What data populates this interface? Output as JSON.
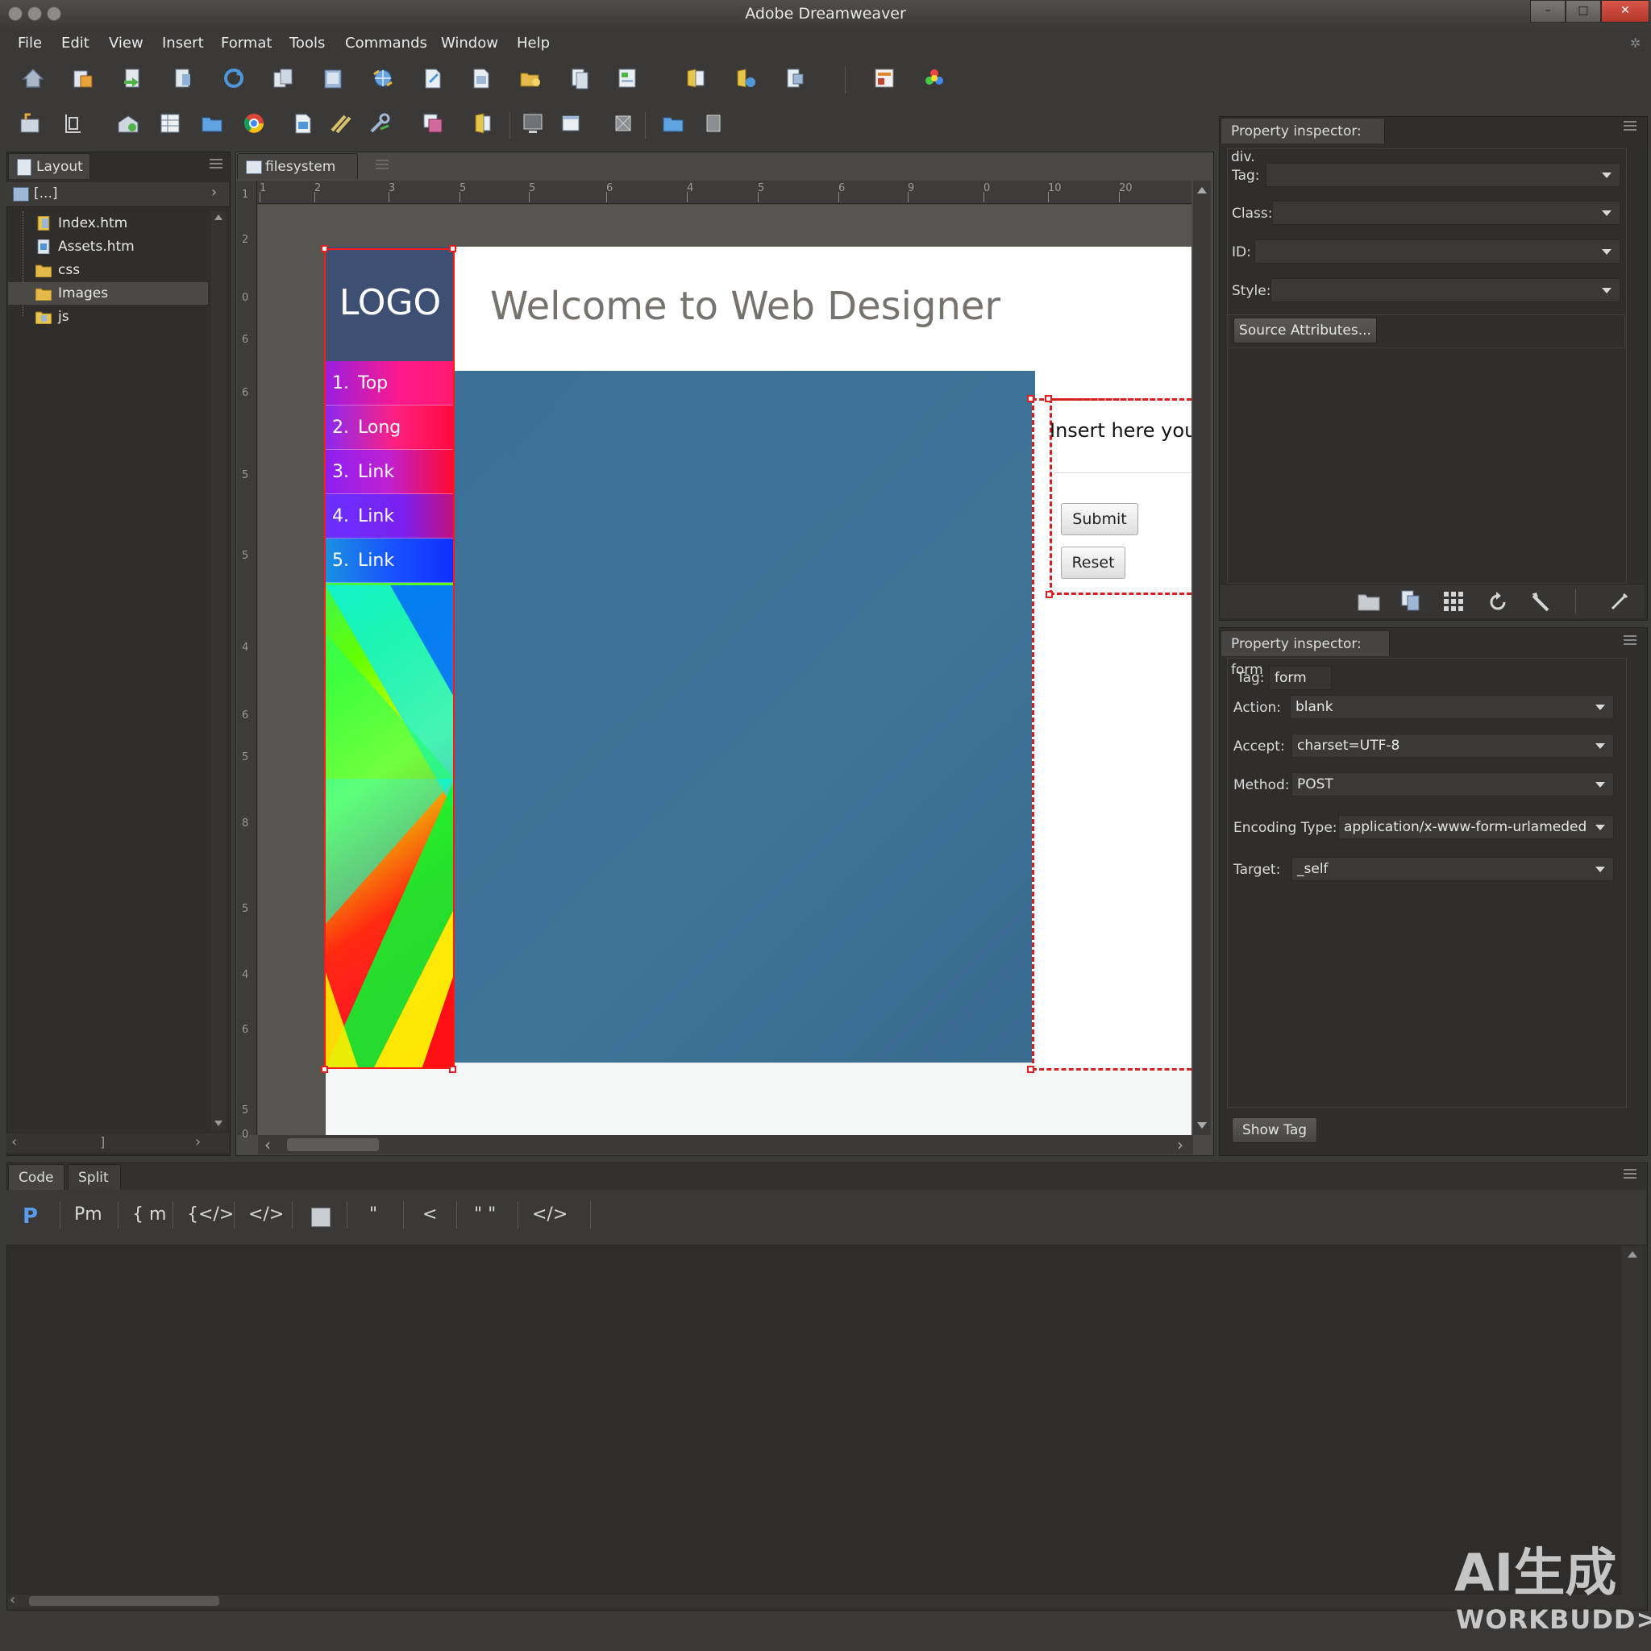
{
  "app": {
    "title": "Adobe Dreamweaver"
  },
  "menu": [
    "File",
    "Edit",
    "View",
    "Insert",
    "Format",
    "Tools",
    "Commands",
    "Window",
    "Help"
  ],
  "window_controls": {
    "minimize": "–",
    "maximize": "□",
    "close": "✕"
  },
  "files_panel": {
    "tab": "Layout",
    "path": "[...]",
    "items": [
      {
        "label": "Index.htm",
        "icon": "html-file-icon"
      },
      {
        "label": "Assets.htm",
        "icon": "html-file-icon"
      },
      {
        "label": "css",
        "icon": "folder-icon"
      },
      {
        "label": "Images",
        "icon": "folder-icon",
        "selected": true
      },
      {
        "label": "js",
        "icon": "folder-icon"
      }
    ],
    "hscroll_mark": "]"
  },
  "document": {
    "tab": "filesystem [...]",
    "ruler_h": [
      "1",
      "2",
      "3",
      "5",
      "5",
      "6",
      "4",
      "5",
      "6",
      "9",
      "0",
      "10",
      "20"
    ],
    "ruler_v": [
      "1",
      "2",
      "0",
      "6",
      "6",
      "5",
      "5",
      "4",
      "6",
      "5",
      "8",
      "5",
      "4",
      "6",
      "5",
      "0"
    ],
    "page": {
      "logo": "LOGO",
      "heading": "Welcome to Web Designer",
      "nav": [
        {
          "num": "1.",
          "label": "Top"
        },
        {
          "num": "2.",
          "label": "Long"
        },
        {
          "num": "3.",
          "label": "Link"
        },
        {
          "num": "4.",
          "label": "Link"
        },
        {
          "num": "5.",
          "label": "Link"
        }
      ],
      "form": {
        "placeholder_text": "Insert here your",
        "submit": "Submit",
        "reset": "Reset"
      }
    }
  },
  "pi_div": {
    "title": "Property inspector: div.",
    "labels": {
      "tag": "Tag:",
      "class": "Class:",
      "id": "ID:",
      "style": "Style:"
    },
    "values": {
      "tag": "",
      "class": "",
      "id": "",
      "style": ""
    },
    "source_button": "Source Attributes..."
  },
  "pi_form": {
    "title": "Property inspector: form",
    "tag_label": "Tag:",
    "tag_value": "form",
    "labels": {
      "action": "Action:",
      "accept": "Accept:",
      "method": "Method:",
      "encoding": "Encoding Type:",
      "target": "Target:"
    },
    "values": {
      "action": "blank",
      "accept": "charset=UTF-8",
      "method": "POST",
      "encoding": "application/x-www-form-urlameded",
      "target": "_self"
    },
    "show_tag_button": "Show Tag"
  },
  "code_panel": {
    "tabs": [
      "Code",
      "Split"
    ],
    "toolbar": [
      "P",
      "Pm",
      "{ m",
      "{</>",
      "</>",
      "\"",
      "<",
      "\" \"",
      "</>"
    ]
  },
  "watermark": {
    "line1": "AI生成",
    "line2": "WORKBUDD>."
  }
}
